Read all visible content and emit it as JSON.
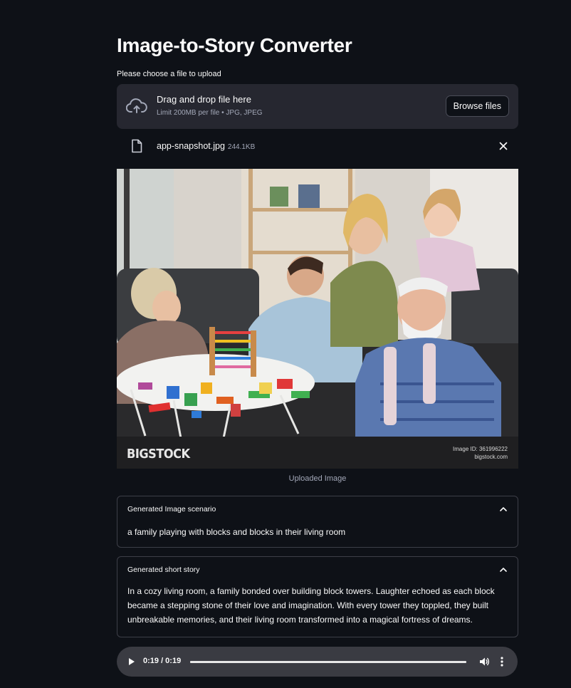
{
  "page": {
    "title": "Image-to-Story Converter",
    "upload_label": "Please choose a file to upload"
  },
  "uploader": {
    "drop_text": "Drag and drop file here",
    "limit_text": "Limit 200MB per file • JPG, JPEG",
    "browse_label": "Browse files",
    "icon": "cloud-upload-icon"
  },
  "file": {
    "name": "app-snapshot.jpg",
    "size": "244.1KB",
    "icon": "file-icon"
  },
  "image": {
    "watermark_brand": "BIGSTOCK",
    "watermark_id": "Image ID: 361996222",
    "watermark_site": "bigstock.com",
    "caption": "Uploaded Image"
  },
  "scenario": {
    "header": "Generated Image scenario",
    "text": "a family playing with blocks and blocks in their living room"
  },
  "story": {
    "header": "Generated short story",
    "text": "In a cozy living room, a family bonded over building block towers. Laughter echoed as each block became a stepping stone of their love and imagination. With every tower they toppled, they built unbreakable memories, and their living room transformed into a magical fortress of dreams."
  },
  "audio": {
    "time": "0:19 / 0:19",
    "progress": 1.0
  },
  "colors": {
    "background": "#0e1117",
    "panel": "#262730",
    "border": "#3d3f48",
    "audio_bar": "#3a3b42"
  }
}
